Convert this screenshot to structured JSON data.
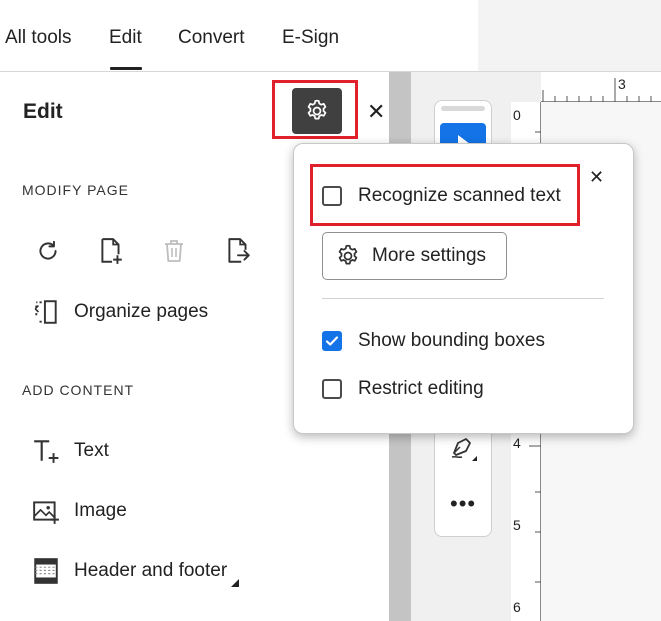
{
  "nav": {
    "tabs": [
      {
        "label": "All tools"
      },
      {
        "label": "Edit",
        "active": true
      },
      {
        "label": "Convert"
      },
      {
        "label": "E-Sign"
      }
    ]
  },
  "panel": {
    "title": "Edit",
    "settings_icon": "gear-icon",
    "close_icon": "close-icon",
    "modify_section": {
      "label": "MODIFY PAGE",
      "tools": [
        {
          "icon": "rotate-icon"
        },
        {
          "icon": "insert-page-icon"
        },
        {
          "icon": "delete-icon",
          "disabled": true
        },
        {
          "icon": "extract-page-icon"
        }
      ],
      "organize_label": "Organize pages"
    },
    "add_section": {
      "label": "ADD CONTENT",
      "items": [
        {
          "label": "Text",
          "icon": "add-text-icon"
        },
        {
          "label": "Image",
          "icon": "add-image-icon"
        },
        {
          "label": "Header and footer",
          "icon": "header-footer-icon"
        }
      ]
    }
  },
  "popover": {
    "recognize_label": "Recognize scanned text",
    "recognize_checked": false,
    "more_settings_label": "More settings",
    "show_bounding_label": "Show bounding boxes",
    "show_bounding_checked": true,
    "restrict_label": "Restrict editing",
    "restrict_checked": false,
    "close_icon": "close-icon"
  },
  "ruler": {
    "top_numbers": [
      "3"
    ],
    "left_numbers": [
      "0",
      "4",
      "5",
      "6"
    ]
  },
  "colors": {
    "accent": "#1473e6",
    "highlight": "#e0202a",
    "gear_button": "#404040"
  }
}
